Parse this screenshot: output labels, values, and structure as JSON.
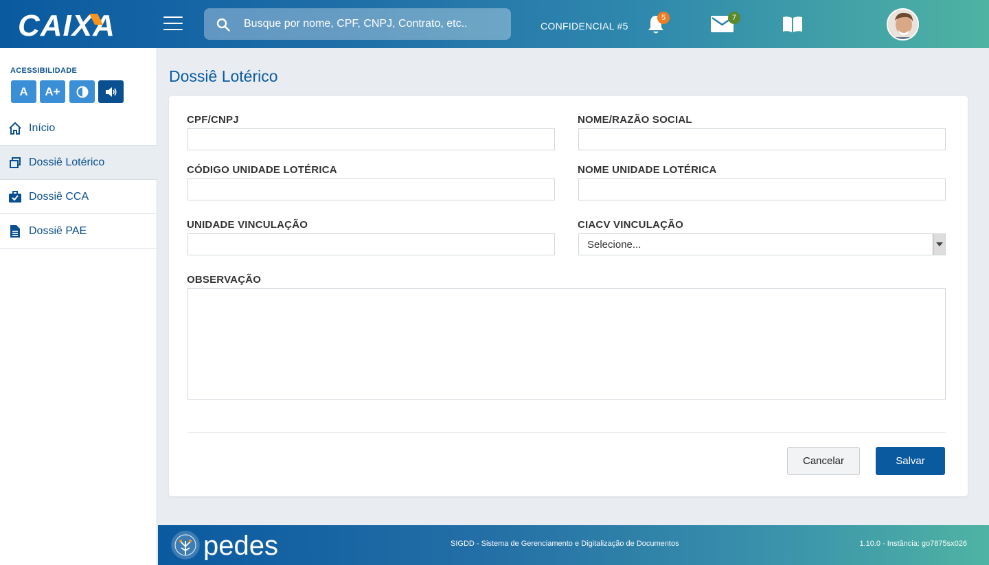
{
  "header": {
    "logo_text": "CAIXA",
    "search_placeholder": "Busque por nome, CPF, CNPJ, Contrato, etc..",
    "confidential_label": "CONFIDENCIAL #5",
    "notifications_count": "5",
    "messages_count": "7",
    "colors": {
      "notif_badge": "#f07d22",
      "msg_badge": "#5b8a2a"
    }
  },
  "sidebar": {
    "accessibility_label": "ACESSIBILIDADE",
    "accessibility_buttons": [
      "A",
      "A+",
      "◐",
      "🔊"
    ],
    "items": [
      {
        "label": "Início",
        "icon": "home-icon"
      },
      {
        "label": "Dossiê Lotérico",
        "icon": "copy-icon",
        "active": true
      },
      {
        "label": "Dossiê CCA",
        "icon": "briefcase-check-icon"
      },
      {
        "label": "Dossiê PAE",
        "icon": "document-icon"
      }
    ]
  },
  "main": {
    "title": "Dossiê Lotérico",
    "fields": {
      "cpf_cnpj": {
        "label": "CPF/CNPJ",
        "value": ""
      },
      "nome_razao": {
        "label": "NOME/RAZÃO SOCIAL",
        "value": ""
      },
      "codigo_unidade": {
        "label": "CÓDIGO UNIDADE LOTÉRICA",
        "value": ""
      },
      "nome_unidade": {
        "label": "NOME UNIDADE LOTÉRICA",
        "value": ""
      },
      "unidade_vinculacao": {
        "label": "UNIDADE VINCULAÇÃO",
        "value": ""
      },
      "ciacv_vinculacao": {
        "label": "CIACV VINCULAÇÃO",
        "selected": "Selecione..."
      },
      "observacao": {
        "label": "OBSERVAÇÃO",
        "value": ""
      }
    },
    "buttons": {
      "cancel": "Cancelar",
      "save": "Salvar"
    }
  },
  "footer": {
    "logo_text": "pedes",
    "system_text": "SIGDD - Sistema de Gerenciamento e Digitalização de Documentos",
    "version_text": "1.10.0 - Instância: go7875sx026"
  }
}
